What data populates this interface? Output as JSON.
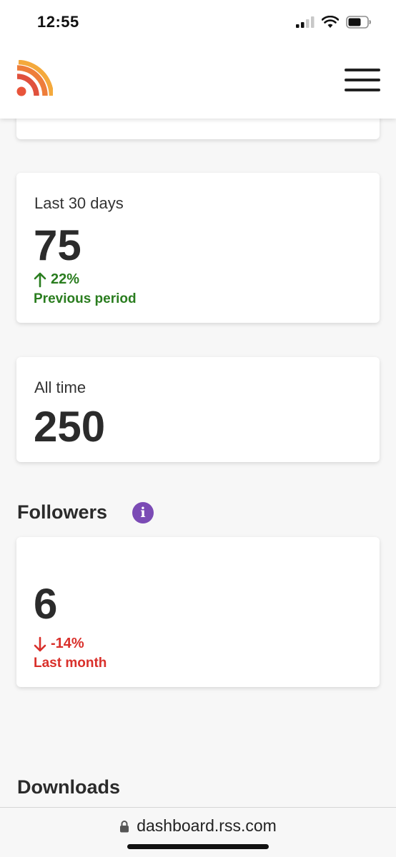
{
  "status_bar": {
    "time": "12:55",
    "icons": [
      "cellular-signal-icon",
      "wifi-icon",
      "battery-icon"
    ]
  },
  "header": {
    "logo": "rss-logo-icon",
    "menu": "hamburger-menu-icon"
  },
  "stats": {
    "last_30_days": {
      "label": "Last 30 days",
      "value": "75",
      "delta": "22%",
      "delta_direction": "up",
      "delta_caption": "Previous period"
    },
    "all_time": {
      "label": "All time",
      "value": "250"
    }
  },
  "followers": {
    "title": "Followers",
    "info_icon": "i",
    "value": "6",
    "delta": "-14%",
    "delta_direction": "down",
    "delta_caption": "Last month"
  },
  "downloads": {
    "title": "Downloads"
  },
  "browser": {
    "url": "dashboard.rss.com"
  },
  "colors": {
    "positive": "#2a7d1f",
    "negative": "#d9302b",
    "info_accent": "#7b4bb5",
    "logo_orange": "#f2a33a",
    "logo_red": "#e8543a"
  }
}
